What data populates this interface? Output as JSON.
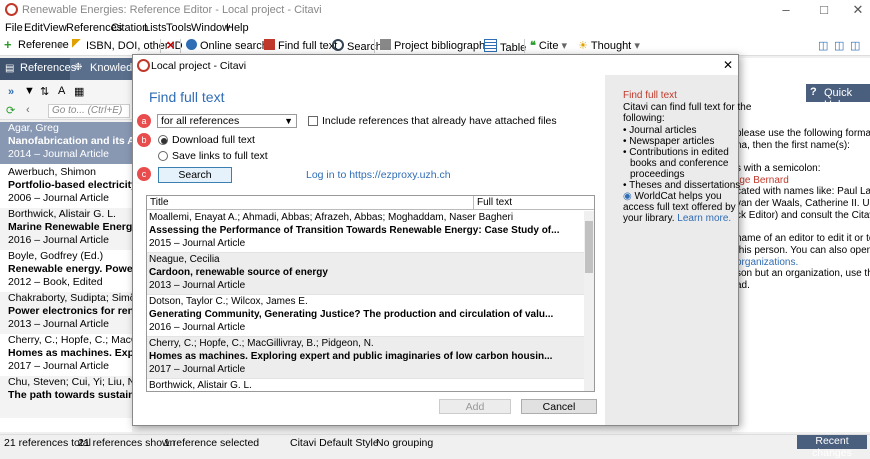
{
  "window": {
    "title": "Renewable Energies: Reference Editor - Local project - Citavi"
  },
  "menu": [
    "File",
    "Edit",
    "View",
    "References",
    "Citation",
    "Lists",
    "Tools",
    "Window",
    "Help"
  ],
  "toolbar": {
    "reference": "Reference",
    "isbn": "ISBN, DOI, other ID",
    "online_search": "Online search",
    "find_full_text": "Find full text",
    "search": "Search",
    "project_bibliography": "Project bibliography",
    "table": "Table",
    "cite": "Cite",
    "thought": "Thought"
  },
  "left": {
    "tabs": [
      "References",
      "Knowledg"
    ],
    "goto_placeholder": "Go to... (Ctrl+E)",
    "items": [
      {
        "author": "Agar, Greg",
        "title": "Nanofabrication and its Applic",
        "meta": "2014 – Journal Article"
      },
      {
        "author": "Awerbuch, Shimon",
        "title": "Portfolio-based electricity ge",
        "meta": "2006 – Journal Article"
      },
      {
        "author": "Borthwick, Alistair G. L.",
        "title": "Marine Renewable Energy Sea",
        "meta": "2016 – Journal Article"
      },
      {
        "author": "Boyle, Godfrey (Ed.)",
        "title": "Renewable energy. Power for",
        "meta": "2012 – Book, Edited"
      },
      {
        "author": "Chakraborty, Sudipta; Simões, M",
        "title": "Power electronics for renewa",
        "meta": "2013 – Journal Article"
      },
      {
        "author": "Cherry, C.; Hopfe, C.; MacGillivr",
        "title": "Homes as machines. Exploring",
        "meta": "2017 – Journal Article"
      },
      {
        "author": "Chu, Steven; Cui, Yi; Liu, Nian",
        "title": "The path towards sustainable",
        "meta": ""
      }
    ]
  },
  "right": {
    "quick_help": "Quick Help",
    "lines": [
      "please use the following format:",
      "na, then the first name(s):",
      "",
      "s with a semicolon:",
      "rge Bernard",
      "",
      "cated with names like: Paul La",
      "van der Waals, Catherine II. Use",
      "ck Editor) and consult the Citavi",
      "",
      "name of an editor to edit it or to",
      "this person. You can also open",
      "organizations.",
      "",
      "son but an organization, use the",
      "ad."
    ]
  },
  "status": {
    "total": "21 references total",
    "shown": "21 references shown",
    "selected": "1 reference selected",
    "style": "Citavi Default Style",
    "grouping": "No grouping",
    "recent": "Recent changes"
  },
  "dialog": {
    "title": "Local project - Citavi",
    "heading": "Find full text",
    "badges": [
      "a",
      "b",
      "c"
    ],
    "scope_select": "for all references",
    "include_checkbox": "Include references that already have attached files",
    "radio_download": "Download full text",
    "radio_links": "Save links to full text",
    "search_button": "Search",
    "login_link": "Log in to https://ezproxy.uzh.ch",
    "columns": [
      "Title",
      "Full text"
    ],
    "rows": [
      {
        "author": "Moallemi, Enayat A.; Ahmadi, Abbas; Afrazeh, Abbas; Moghaddam, Naser Bagheri",
        "title": "Assessing the Performance of Transition Towards Renewable Energy: Case Study of...",
        "meta": "2015 – Journal Article"
      },
      {
        "author": "Neague, Cecilia",
        "title": "Cardoon, renewable source of energy",
        "meta": "2013 – Journal Article"
      },
      {
        "author": "Dotson, Taylor C.; Wilcox, James E.",
        "title": "Generating Community, Generating Justice? The production and circulation of valu...",
        "meta": "2016 – Journal Article"
      },
      {
        "author": "Cherry, C.; Hopfe, C.; MacGillivray, B.; Pidgeon, N.",
        "title": "Homes as machines. Exploring expert and public imaginaries of low carbon housin...",
        "meta": "2017 – Journal Article"
      },
      {
        "author": "Borthwick, Alistair G. L.",
        "title": "",
        "meta": ""
      }
    ],
    "add_button": "Add",
    "cancel_button": "Cancel",
    "sidebar": {
      "heading": "Find full text",
      "intro": [
        "Citavi can find full text for the",
        "following:"
      ],
      "bullets": [
        "Journal articles",
        "Newspaper articles",
        "Contributions in edited",
        "books and conference",
        "proceedings",
        "Theses and dissertations"
      ],
      "worldcat": [
        "WorldCat helps you",
        "access full text offered by",
        "your library."
      ],
      "learn_more": "Learn more."
    }
  }
}
